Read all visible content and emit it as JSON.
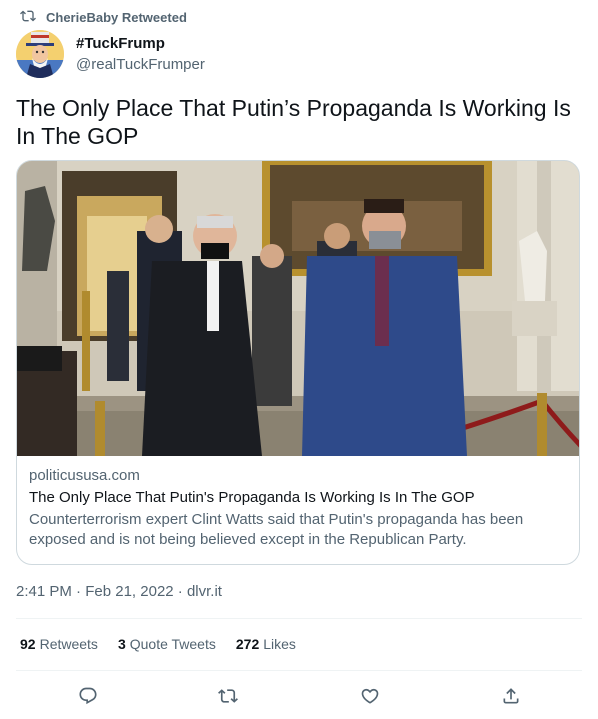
{
  "retweet": {
    "label": "CherieBaby Retweeted",
    "icon": "retweet-icon"
  },
  "author": {
    "display_name": "#TuckFrump",
    "handle": "@realTuckFrumper",
    "avatar_icon": "uncle-sam-avatar"
  },
  "tweet": {
    "text": "The Only Place That Putin’s Propaganda Is Working Is In The GOP"
  },
  "card": {
    "domain": "politicususa.com",
    "title": "The Only Place That Putin's Propaganda Is Working Is In The GOP",
    "description": "Counterterrorism expert Clint Watts said that Putin's propaganda has been exposed and is not being believed except in the Republican Party."
  },
  "meta": {
    "time": "2:41 PM",
    "date": "Feb 21, 2022",
    "source": "dlvr.it",
    "separator": "·"
  },
  "stats": {
    "retweets_count": "92",
    "retweets_label": "Retweets",
    "quotes_count": "3",
    "quotes_label": "Quote Tweets",
    "likes_count": "272",
    "likes_label": "Likes"
  },
  "actions": [
    "reply-icon",
    "retweet-icon",
    "like-icon",
    "share-icon"
  ],
  "colors": {
    "text_primary": "#0f1419",
    "text_secondary": "#536471",
    "border": "#cfd9de",
    "divider": "#eff3f4"
  }
}
